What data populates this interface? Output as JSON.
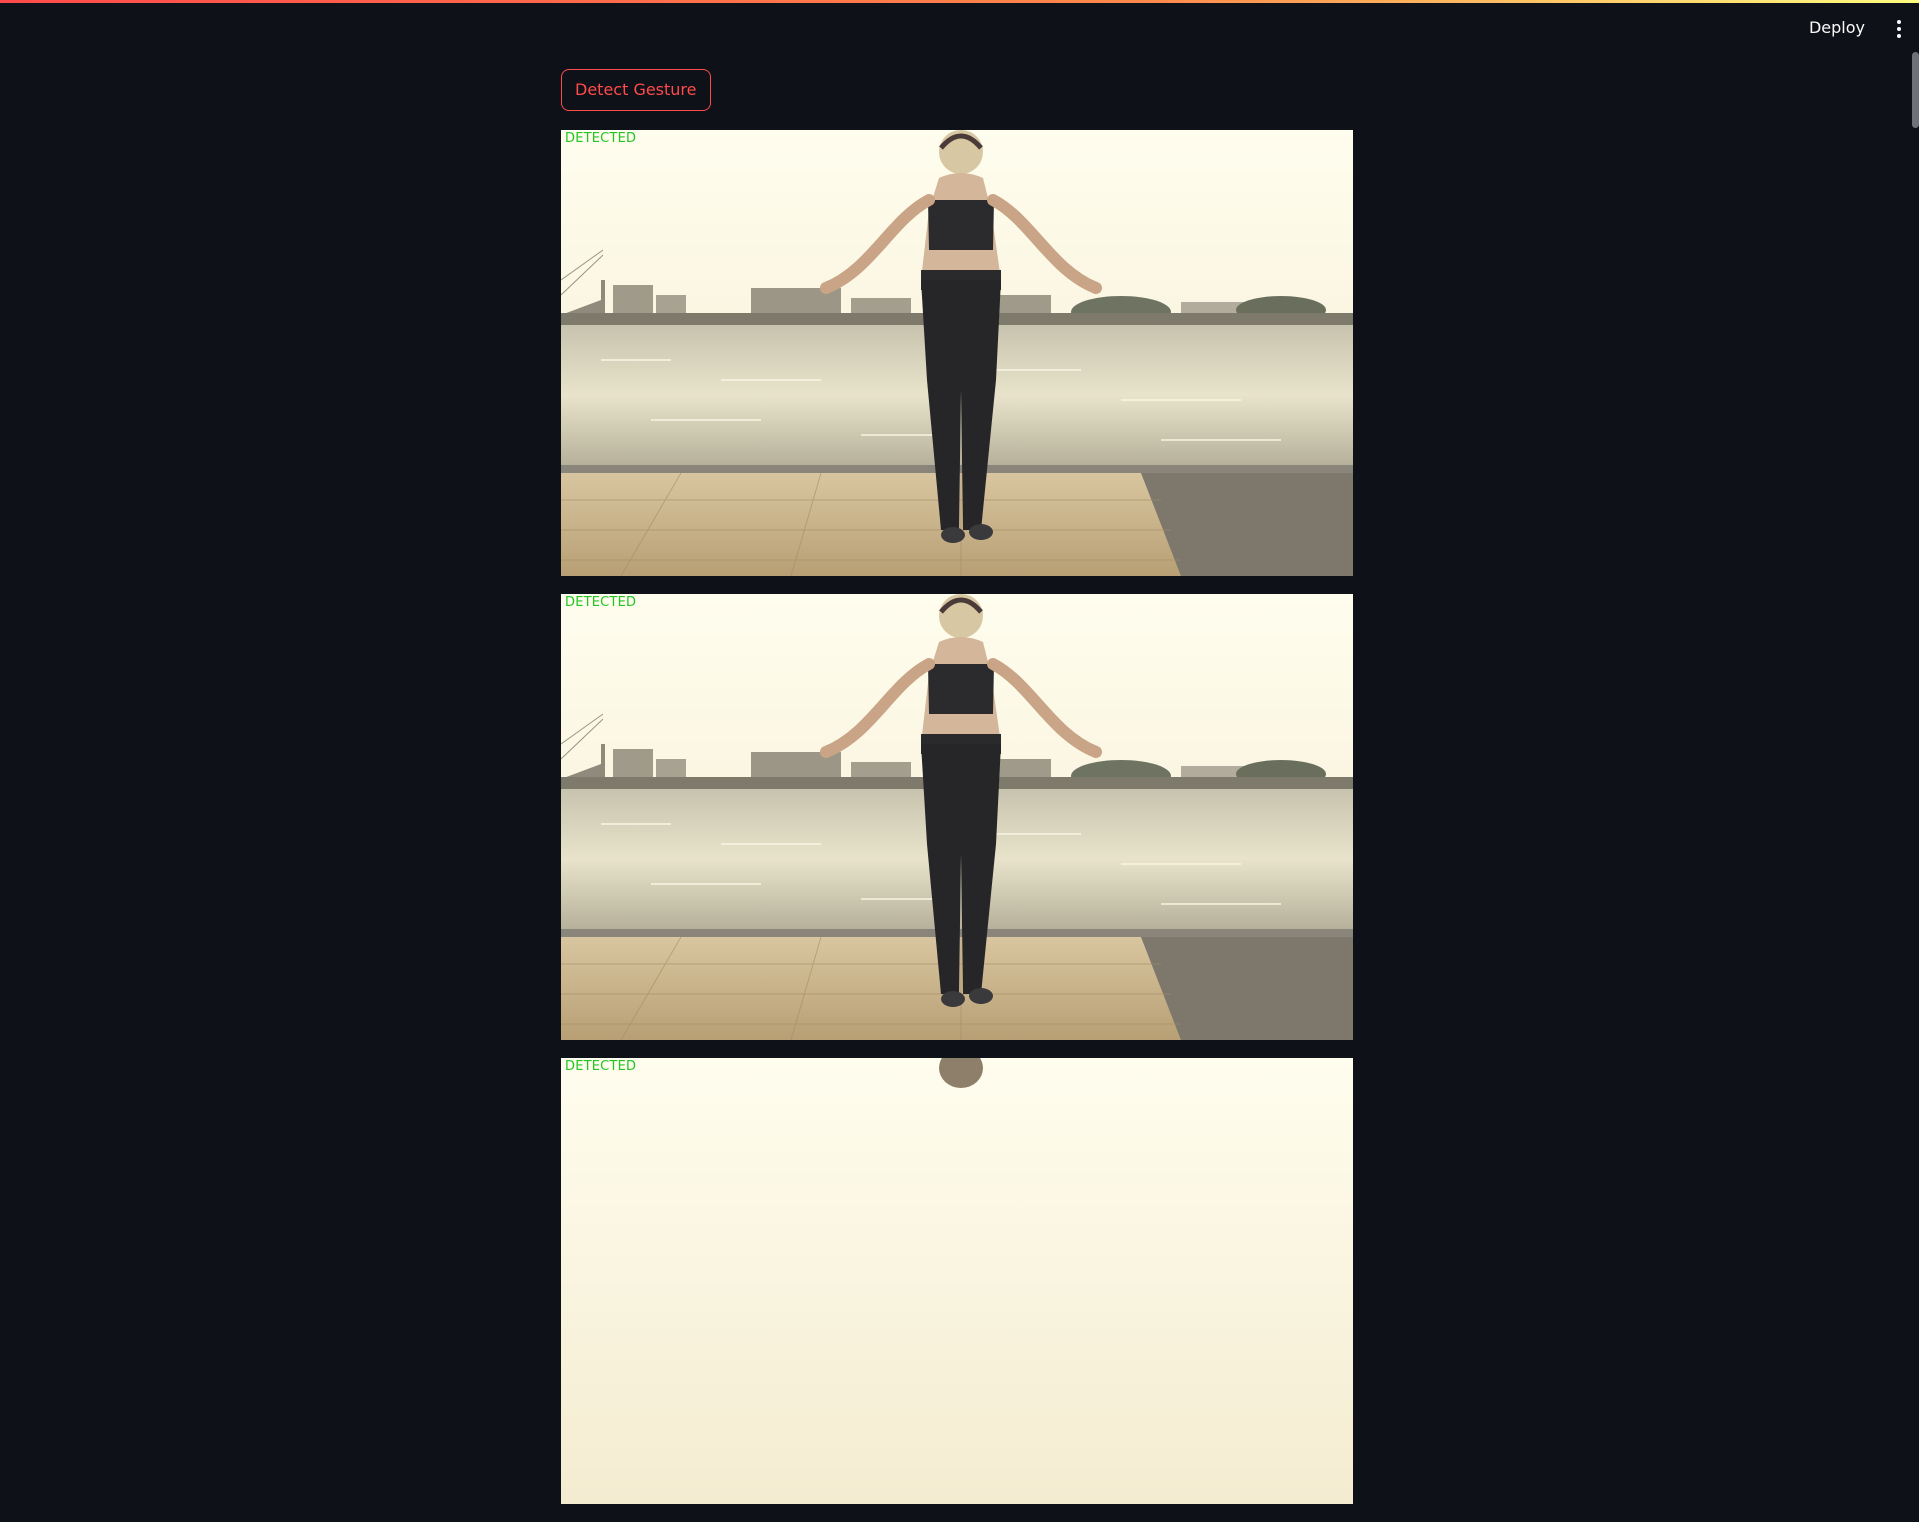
{
  "header": {
    "deploy_label": "Deploy",
    "menu_icon": "vertical-dots-icon"
  },
  "main": {
    "detect_button_label": "Detect Gesture",
    "frames": [
      {
        "status": "DETECTED"
      },
      {
        "status": "DETECTED"
      },
      {
        "status": "DETECTED"
      }
    ]
  },
  "colors": {
    "background": "#0e1117",
    "accent": "#ff4b4b",
    "detected_text": "#22c622"
  }
}
